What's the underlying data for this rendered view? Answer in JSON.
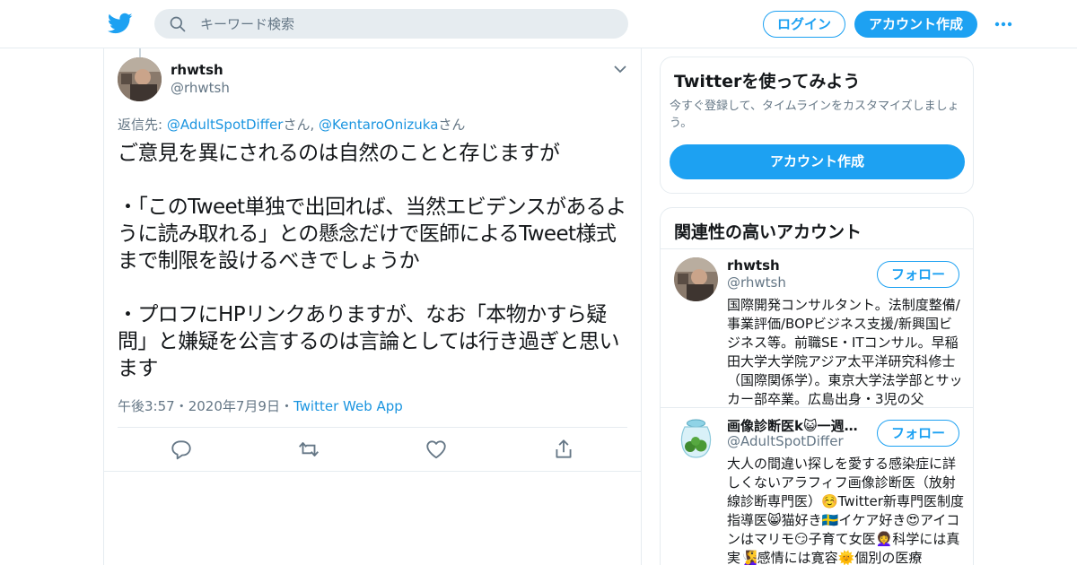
{
  "colors": {
    "accent": "#1da1f2",
    "link": "#1b95e0",
    "muted": "#657786",
    "border": "#e6ecf0"
  },
  "nav": {
    "logo_icon": "twitter-bird-icon",
    "search_placeholder": "キーワード検索",
    "login_label": "ログイン",
    "signup_label": "アカウント作成",
    "more_icon": "more-dots-icon"
  },
  "tweet": {
    "name": "rhwtsh",
    "handle": "@rhwtsh",
    "reply_prefix": "返信先: ",
    "reply_to_1": "@AdultSpotDiffer",
    "reply_suffix_1": "さん, ",
    "reply_to_2": "@KentaroOnizuka",
    "reply_suffix_2": "さん",
    "text": "ご意見を異にされるのは自然のことと存じますが\n\n・「このTweet単独で出回れば、当然エビデンスがあるように読み取れる」との懸念だけで医師によるTweet様式まで制限を設けるべきでしょうか\n\n・プロフにHPリンクありますが、なお「本物かすら疑問」と嫌疑を公言するのは言論としては行き過ぎと思います",
    "time": "午後3:57",
    "date": "2020年7月9日",
    "source": "Twitter Web App",
    "dot": "・",
    "actions": [
      "reply-icon",
      "retweet-icon",
      "like-icon",
      "share-icon"
    ]
  },
  "sidebar": {
    "promo": {
      "title": "Twitterを使ってみよう",
      "description": "今すぐ登録して、タイムラインをカスタマイズしましょう。",
      "button": "アカウント作成"
    },
    "related": {
      "title": "関連性の高いアカウント",
      "follow_label": "フォロー",
      "accounts": [
        {
          "name": "rhwtsh",
          "handle": "@rhwtsh",
          "bio": "国際開発コンサルタント。法制度整備/事業評価/BOPビジネス支援/新興国ビジネス等。前職SE・ITコンサル。早稲田大学大学院アジア太平洋研究科修士（国際関係学）。東京大学法学部とサッカー部卒業。広島出身・3児の父"
        },
        {
          "name": "画像診断医k😺一週…",
          "handle": "@AdultSpotDiffer",
          "bio": "大人の間違い探しを愛する感染症に詳しくないアラフィフ画像診断医（放射線診断専門医）☺️Twitter新専門医制度指導医😸猫好き🇸🇪イケア好き😍アイコンはマリモ😏子育て女医👩‍🦱科学には真実🧏‍♀️感情には寛容🌞個別の医療"
        }
      ]
    }
  }
}
